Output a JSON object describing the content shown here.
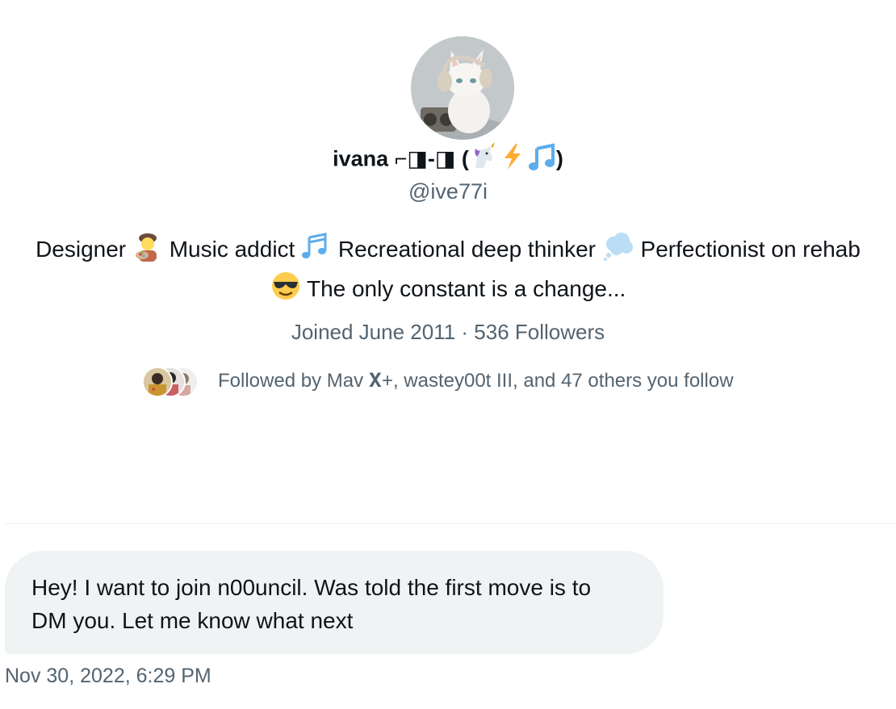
{
  "profile": {
    "display_name_text": "ivana ⌐◨-◨ (",
    "display_name_close": ")",
    "handle": "@ive77i",
    "bio_part1": "Designer ",
    "bio_part2": " Music addict ",
    "bio_part3": " Recreational deep thinker ",
    "bio_part4": " Perfectionist on rehab ",
    "bio_part5": " The only constant is a change...",
    "meta": "Joined June 2011 · 536 Followers",
    "followed_by": "Followed by Mav 𝐗+, wastey00t III, and 47 others you follow"
  },
  "icons": {
    "avatar": "white-cat-with-headphones-avatar",
    "name_emojis": [
      "unicorn-icon",
      "lightning-icon",
      "music-note-icon"
    ],
    "bio_emojis": [
      "artist-icon",
      "music-notes-icon",
      "thought-bubble-icon",
      "sunglasses-smiley-icon"
    ]
  },
  "conversation": {
    "message": "Hey! I want to join n00uncil. Was told the first move is to DM you. Let me know what next",
    "timestamp": "Nov 30, 2022, 6:29 PM"
  },
  "colors": {
    "text_primary": "#0f1419",
    "text_secondary": "#536471",
    "bubble_bg": "#eff3f4",
    "accent_blue": "#55acee"
  }
}
